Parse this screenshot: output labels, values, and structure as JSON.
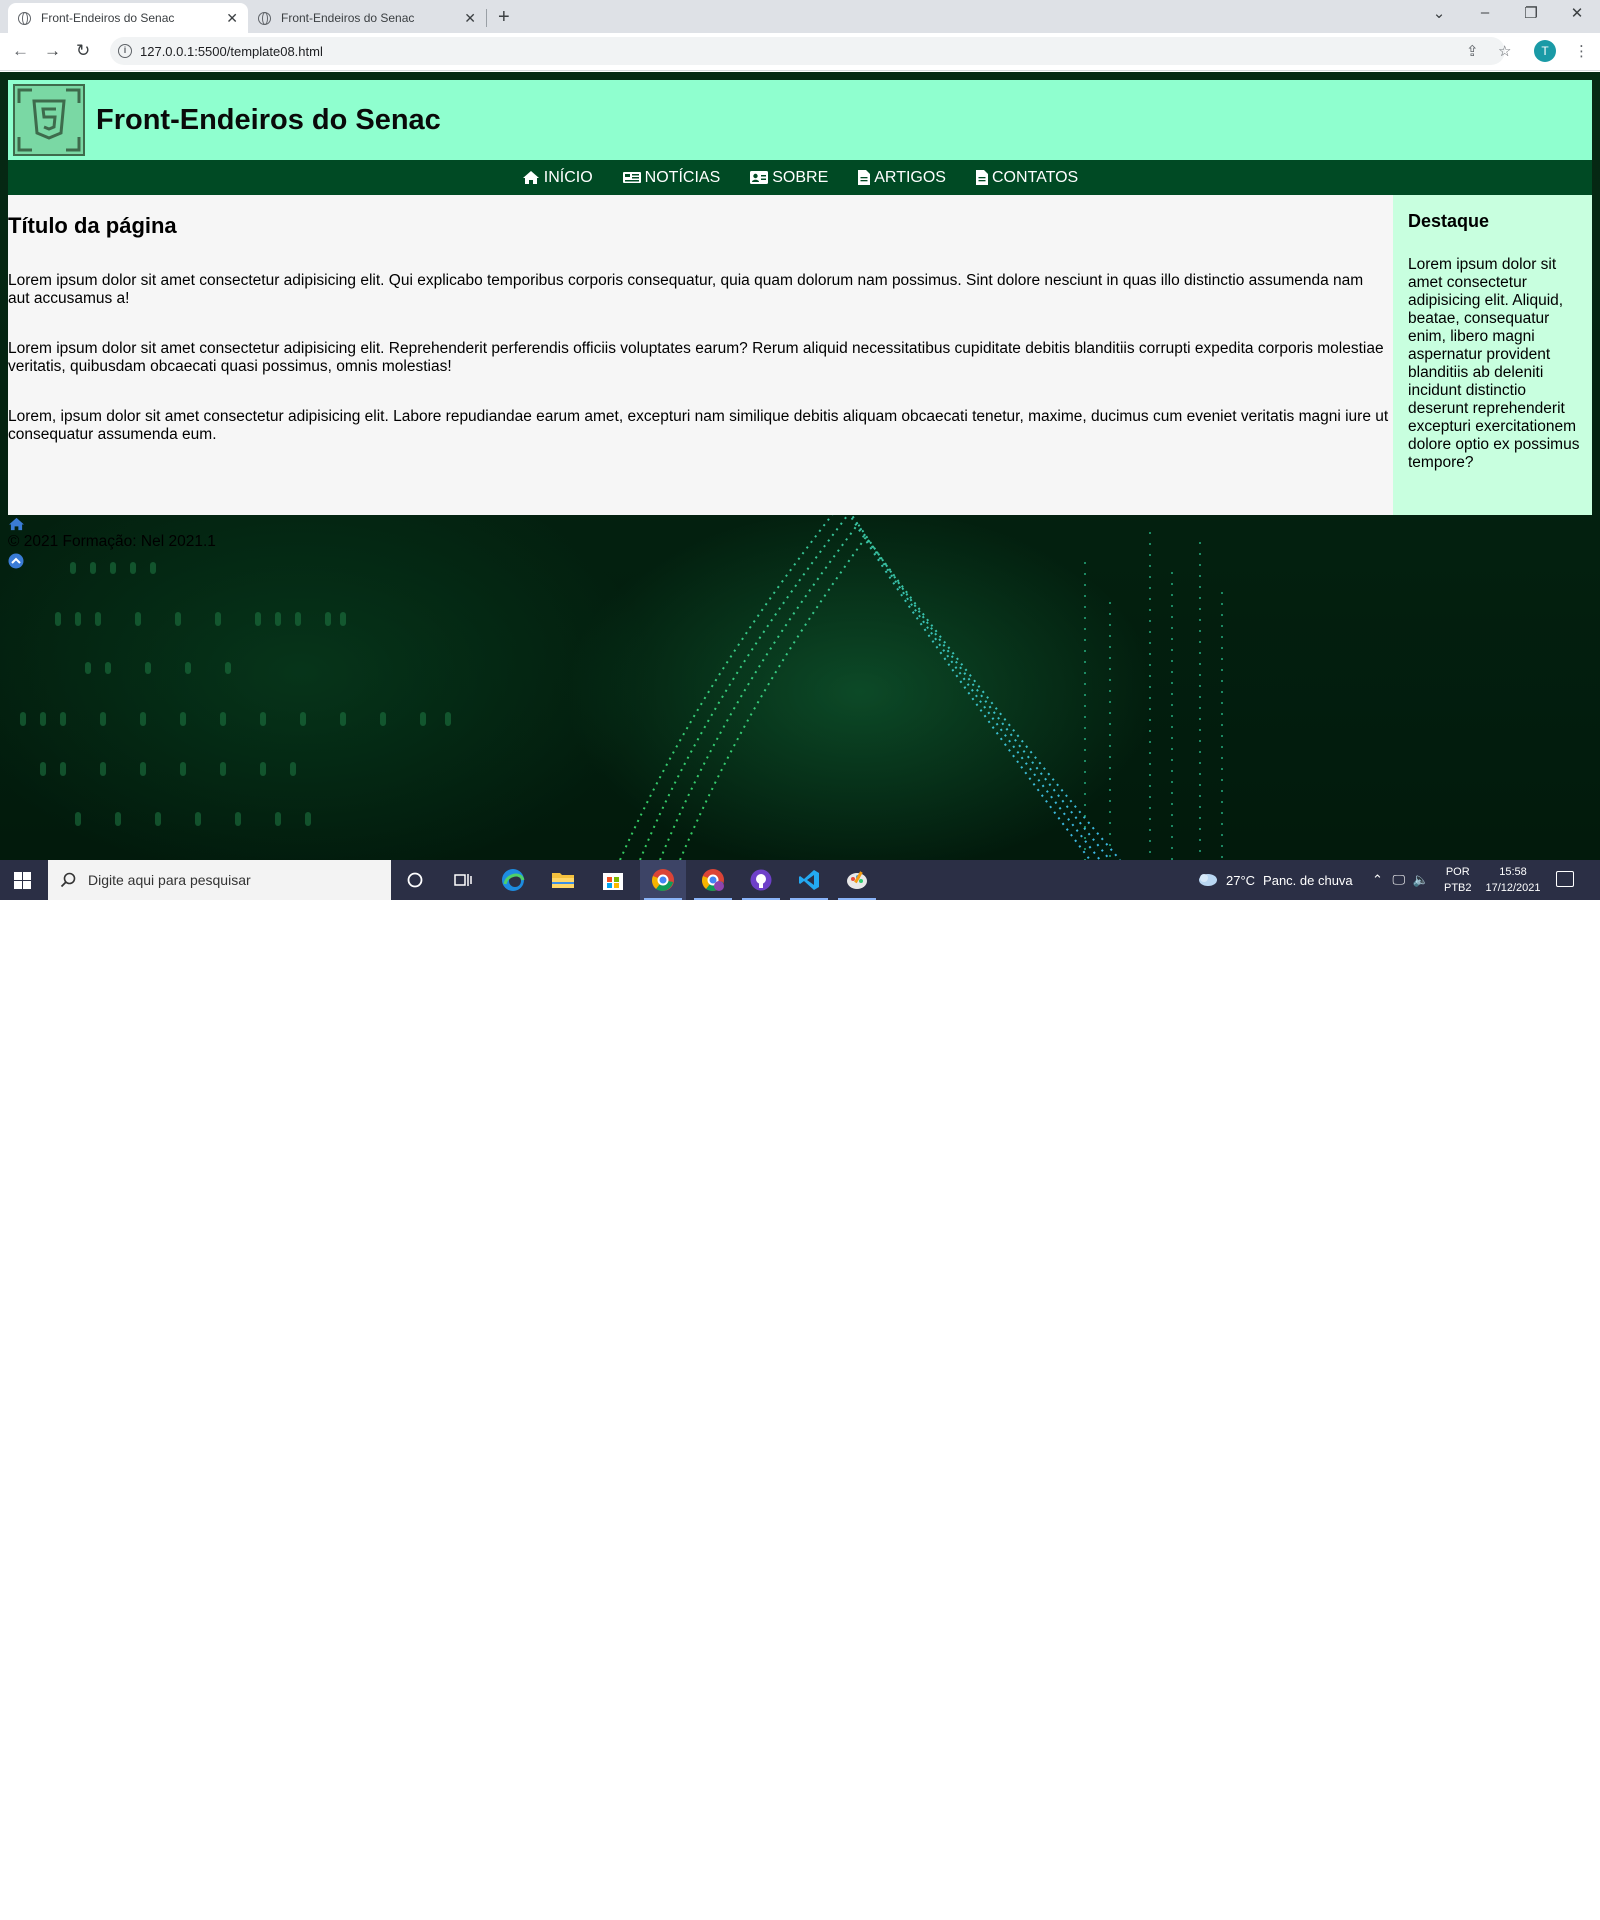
{
  "browser": {
    "tabs": [
      {
        "title": "Front-Endeiros do Senac",
        "active": true
      },
      {
        "title": "Front-Endeiros do Senac",
        "active": false
      }
    ],
    "url": "127.0.0.1:5500/template08.html",
    "profile_initial": "T"
  },
  "site": {
    "title": "Front-Endeiros do Senac",
    "nav": [
      {
        "label": "INÍCIO",
        "icon": "home-icon"
      },
      {
        "label": "NOTÍCIAS",
        "icon": "newspaper-icon"
      },
      {
        "label": "SOBRE",
        "icon": "id-card-icon"
      },
      {
        "label": "ARTIGOS",
        "icon": "file-icon"
      },
      {
        "label": "CONTATOS",
        "icon": "file-icon"
      }
    ],
    "main": {
      "title": "Título da página",
      "paragraphs": [
        "Lorem ipsum dolor sit amet consectetur adipisicing elit. Qui explicabo temporibus corporis consequatur, quia quam dolorum nam possimus. Sint dolore nesciunt in quas illo distinctio assumenda nam aut accusamus a!",
        "Lorem ipsum dolor sit amet consectetur adipisicing elit. Reprehenderit perferendis officiis voluptates earum? Rerum aliquid necessitatibus cupiditate debitis blanditiis corrupti expedita corporis molestiae veritatis, quibusdam obcaecati quasi possimus, omnis molestias!",
        "Lorem, ipsum dolor sit amet consectetur adipisicing elit. Labore repudiandae earum amet, excepturi nam similique debitis aliquam obcaecati tenetur, maxime, ducimus cum eveniet veritatis magni iure ut consequatur assumenda eum."
      ]
    },
    "aside": {
      "title": "Destaque",
      "text": "Lorem ipsum dolor sit amet consectetur adipisicing elit. Aliquid, beatae, consequatur enim, libero magni aspernatur provident blanditiis ab deleniti incidunt distinctio deserunt reprehenderit excepturi exercitationem dolore optio ex possimus tempore?"
    },
    "footer": {
      "copyright": "© 2021 Formação: Nel 2021.1"
    }
  },
  "taskbar": {
    "search_placeholder": "Digite aqui para pesquisar",
    "weather_temp": "27°C",
    "weather_desc": "Panc. de chuva",
    "lang_line1": "POR",
    "lang_line2": "PTB2",
    "time": "15:58",
    "date": "17/12/2021"
  },
  "colors": {
    "header_bg": "#8fffcf",
    "nav_bg": "#004a24",
    "main_bg": "#f6f6f6",
    "aside_bg": "#c8ffdf"
  }
}
